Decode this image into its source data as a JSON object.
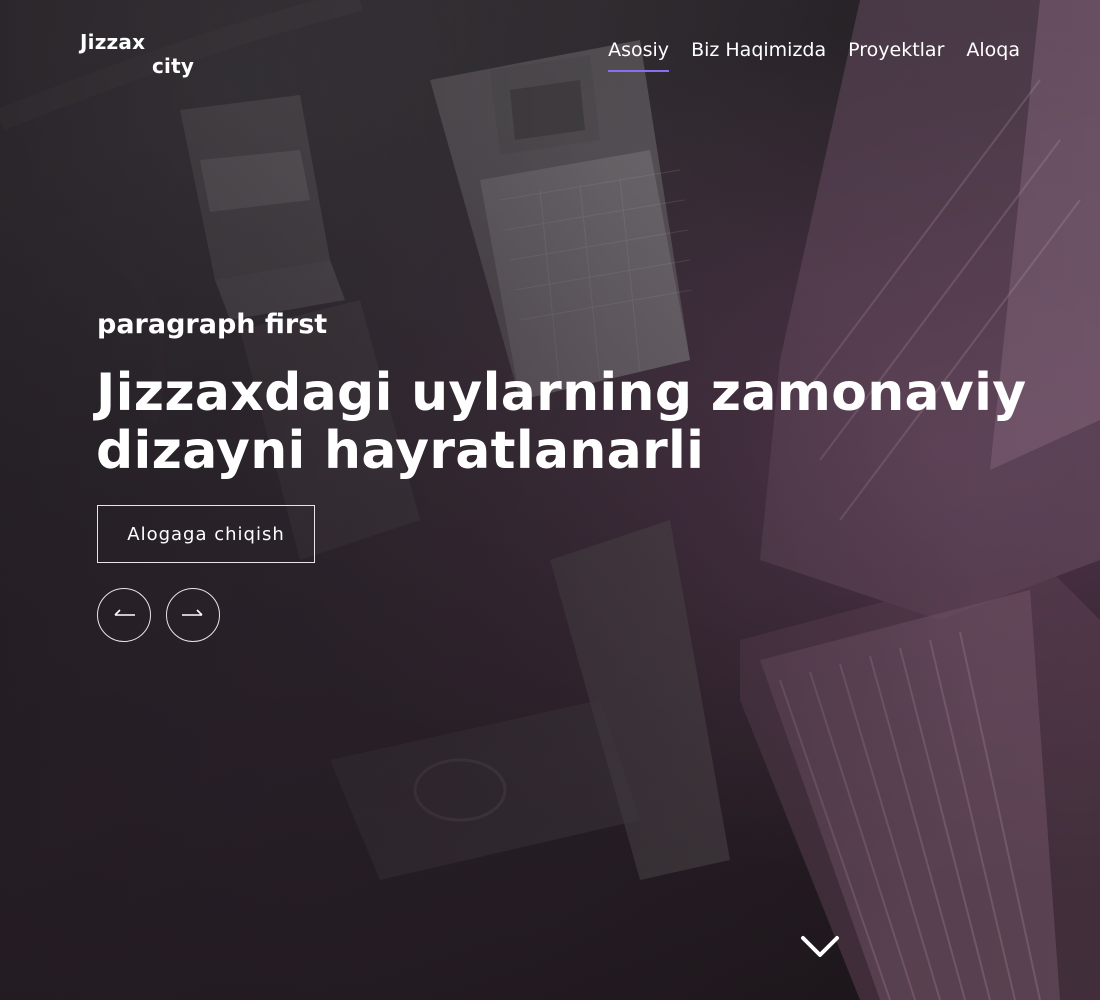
{
  "logo": {
    "line1": "Jizzax",
    "line2": "city"
  },
  "nav": {
    "items": [
      {
        "label": "Asosiy",
        "active": true
      },
      {
        "label": "Biz Haqimizda",
        "active": false
      },
      {
        "label": "Proyektlar",
        "active": false
      },
      {
        "label": "Aloqa",
        "active": false
      }
    ],
    "active_underline_color": "#8a6df0"
  },
  "hero": {
    "subtitle": "paragraph first",
    "headline_line1": "Jizzaxdagi uylarning zamonaviy",
    "headline_line2": "dizayni hayratlanarli",
    "cta_label": "Alogaga chiqish",
    "prev_icon": "arrow-left-icon",
    "next_icon": "arrow-right-icon",
    "scroll_icon": "chevron-down-icon"
  },
  "colors": {
    "text": "#ffffff",
    "background": "#2a2328",
    "button_border": "#e8e4ea"
  }
}
